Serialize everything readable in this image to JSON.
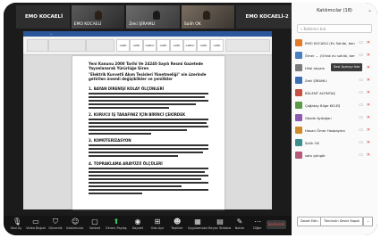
{
  "meeting": {
    "thumbnails": [
      {
        "name": "EMO KOCAELİ",
        "style": "big"
      },
      {
        "name": "EMO KOCAELİ",
        "style": "video"
      },
      {
        "name": "Zeki ŞİRAMLI",
        "style": "video"
      },
      {
        "name": "Salih OK",
        "style": "video"
      },
      {
        "name": "EMO KOCAELİ-2",
        "style": "big"
      }
    ],
    "document": {
      "window_title": "...",
      "heading": "Yeni Kanunu 2000 Tarihi Ve 24240 Sayılı Resmi Gazetede Yayımlanarak Yürürlüğe Giren",
      "subheading": "\"Elektrik Kuvvetli Akım Tesisleri Yönetmeliği\" nin üzerinde getirilen önemli değişiklikler ve yenilikler",
      "sections": [
        "1. BAYAN DİRENİŞİ KOLAY ÖLÇÜNLERİ",
        "2. KURUCU İŞ TARAFINIZ İÇİN BİRİNCİ ÇEKİRDEK",
        "3. KOMÜTERİZASYON",
        "4. TOPRAKLAMA ARAYÜZÜ ÖLÇÜLERİ"
      ]
    },
    "toolbar": [
      {
        "icon": "mic-icon",
        "label": "Sesi Aç"
      },
      {
        "icon": "video-icon",
        "label": "Video Başlat"
      },
      {
        "icon": "shield-icon",
        "label": "Güvenlik"
      },
      {
        "icon": "participants-icon",
        "label": "Katılımcılar"
      },
      {
        "icon": "chat-icon",
        "label": "Sohbet"
      },
      {
        "icon": "share-icon",
        "label": "Ekranı Paylaş"
      },
      {
        "icon": "record-icon",
        "label": "Kaydet"
      },
      {
        "icon": "breakout-icon",
        "label": "Oda Ayır"
      },
      {
        "icon": "reactions-icon",
        "label": "Tepkiler"
      },
      {
        "icon": "apps-icon",
        "label": "Uygulamalar"
      },
      {
        "icon": "whiteboard-icon",
        "label": "Beyaz Tahtalar"
      },
      {
        "icon": "notes-icon",
        "label": "Notlar"
      },
      {
        "icon": "more-icon",
        "label": "Diğer"
      }
    ],
    "end_label": "Sonlandır"
  },
  "panel": {
    "title": "Katılımcılar (18)",
    "search_placeholder": "Katılımcı bul",
    "participants": [
      {
        "name": "EMO KOCAELİ (Ev Sahibi, ben)",
        "color": "#e07b2a"
      },
      {
        "name": "Ömer … (Ortak ev sahibi, ben)",
        "color": "#4a7ec2"
      },
      {
        "name": "Hilal akçam (Ben)",
        "color": "#7a7a7a",
        "button": "Sesi Açmayı İste"
      },
      {
        "name": "Zeki ŞİRAMLI",
        "color": "#3a6fb5"
      },
      {
        "name": "BÜLENT ALTINTAŞ",
        "color": "#c94f43"
      },
      {
        "name": "Çağatay Bilge KELEŞ",
        "color": "#5c9a48"
      },
      {
        "name": "Gözde Aydoğan",
        "color": "#8e59b0"
      },
      {
        "name": "Hasan Ömer Hasbaydın",
        "color": "#d08a2c"
      },
      {
        "name": "Salih OK",
        "color": "#3c8f8f"
      },
      {
        "name": "satu güngör",
        "color": "#b55a7a"
      }
    ],
    "invite_label": "Davet Edin",
    "mute_all_label": "Tümünün Sesini Kapat",
    "more_label": "..."
  }
}
